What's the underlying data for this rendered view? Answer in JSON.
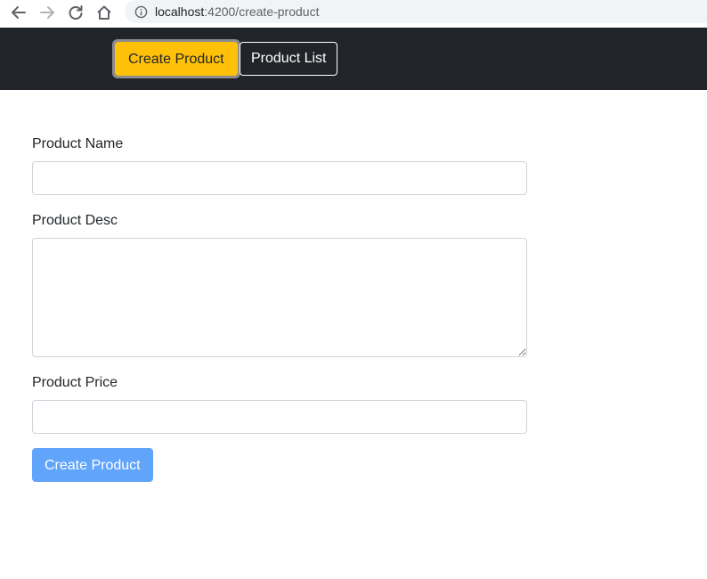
{
  "browser": {
    "url_host": "localhost",
    "url_path": ":4200/create-product",
    "icons": {
      "back": "arrow-left-icon",
      "forward": "arrow-right-icon",
      "reload": "reload-icon",
      "home": "home-icon",
      "info": "info-icon"
    }
  },
  "navbar": {
    "create_label": "Create Product",
    "list_label": "Product List",
    "colors": {
      "background": "#212529",
      "active": "#ffc107"
    }
  },
  "form": {
    "name_label": "Product Name",
    "name_value": "",
    "desc_label": "Product Desc",
    "desc_value": "",
    "price_label": "Product Price",
    "price_value": "",
    "submit_label": "Create Product",
    "colors": {
      "submit": "#61a4fb"
    }
  }
}
